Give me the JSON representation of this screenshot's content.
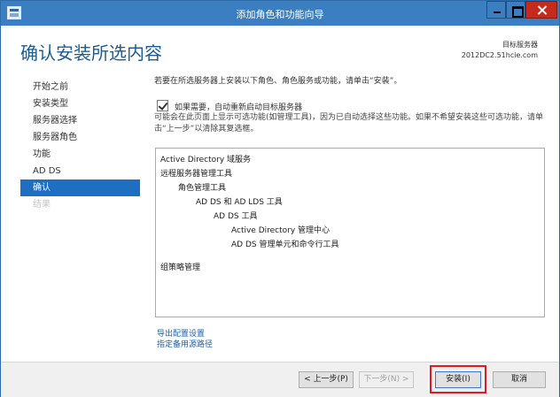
{
  "window": {
    "title": "添加角色和功能向导"
  },
  "header": {
    "page_title": "确认安装所选内容",
    "target_label": "目标服务器",
    "target_server": "2012DC2.51hcie.com"
  },
  "nav": {
    "items": [
      {
        "label": "开始之前",
        "state": "normal"
      },
      {
        "label": "安装类型",
        "state": "normal"
      },
      {
        "label": "服务器选择",
        "state": "normal"
      },
      {
        "label": "服务器角色",
        "state": "normal"
      },
      {
        "label": "功能",
        "state": "normal"
      },
      {
        "label": "AD DS",
        "state": "normal"
      },
      {
        "label": "确认",
        "state": "active"
      },
      {
        "label": "结果",
        "state": "disabled"
      }
    ]
  },
  "content": {
    "intro": "若要在所选服务器上安装以下角色、角色服务或功能，请单击“安装”。",
    "restart_checkbox_label": "如果需要，自动重新启动目标服务器",
    "restart_checked": true,
    "note": "可能会在此页面上显示可选功能(如管理工具)，因为已自动选择这些功能。如果不希望安装这些可选功能，请单击“上一步”以清除其复选框。"
  },
  "features": [
    {
      "label": "Active Directory 域服务",
      "level": 0
    },
    {
      "label": "远程服务器管理工具",
      "level": 0
    },
    {
      "label": "角色管理工具",
      "level": 1
    },
    {
      "label": "AD DS 和 AD LDS 工具",
      "level": 2
    },
    {
      "label": "AD DS 工具",
      "level": 3
    },
    {
      "label": "Active Directory 管理中心",
      "level": 4
    },
    {
      "label": "AD DS 管理单元和命令行工具",
      "level": 4
    },
    {
      "label": "组策略管理",
      "level": 0
    }
  ],
  "links": {
    "export": "导出配置设置",
    "alt_source": "指定备用源路径"
  },
  "footer": {
    "prev": "< 上一步(P)",
    "next": "下一步(N) >",
    "install": "安装(I)",
    "cancel": "取消"
  },
  "colors": {
    "titlebar": "#3c7fc0",
    "accent": "#1e6fc2",
    "highlight": "#e01b1b"
  }
}
